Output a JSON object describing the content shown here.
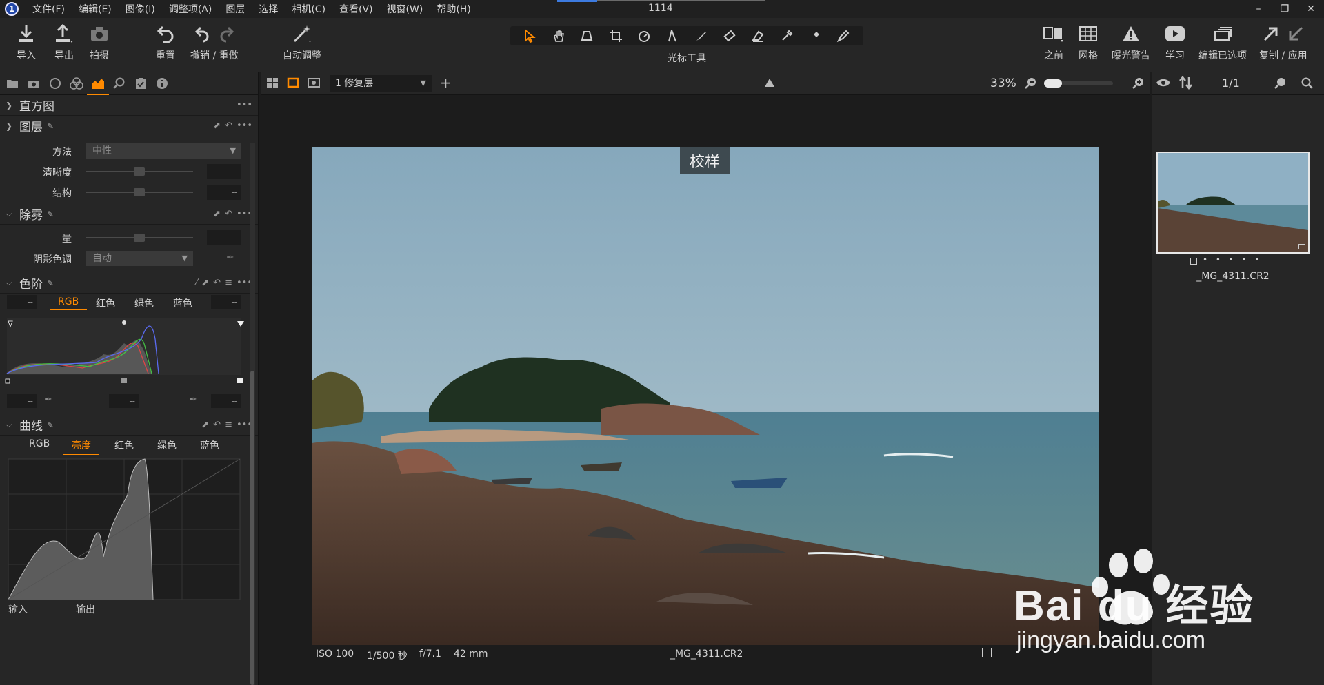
{
  "menubar": {
    "logo": "1",
    "items": [
      "文件(F)",
      "编辑(E)",
      "图像(I)",
      "调整项(A)",
      "图层",
      "选择",
      "相机(C)",
      "查看(V)",
      "视窗(W)",
      "帮助(H)"
    ],
    "title": "1114",
    "win_controls": [
      "–",
      "❐",
      "✕"
    ]
  },
  "toolbar": {
    "import": "导入",
    "export": "导出",
    "capture": "拍摄",
    "reset": "重置",
    "undo_redo": "撤销 / 重做",
    "auto_adjust": "自动调整",
    "cursor_tools": "光标工具",
    "before": "之前",
    "grid": "网格",
    "exposure_warning": "曝光警告",
    "learn": "学习",
    "edit_selected": "编辑已选项",
    "copy_apply": "复制 / 应用"
  },
  "left_panel": {
    "histogram_title": "直方图",
    "layers_title": "图层",
    "method_label": "方法",
    "method_value": "中性",
    "clarity_label": "清晰度",
    "structure_label": "结构",
    "dehaze_title": "除雾",
    "amount_label": "量",
    "shadow_tone_label": "阴影色调",
    "shadow_tone_value": "自动",
    "levels_title": "色阶",
    "levels_tabs": [
      "RGB",
      "红色",
      "绿色",
      "蓝色"
    ],
    "curves_title": "曲线",
    "curves_tabs": [
      "RGB",
      "亮度",
      "红色",
      "绿色",
      "蓝色"
    ],
    "input_label": "输入",
    "output_label": "输出",
    "empty_value": "--"
  },
  "viewer": {
    "layer_select": "1 修复层",
    "zoom": "33%",
    "proof_label": "校样",
    "iso": "ISO 100",
    "shutter": "1/500 秒",
    "aperture": "f/7.1",
    "focal": "42 mm",
    "filename": "_MG_4311.CR2"
  },
  "browser": {
    "count": "1/1",
    "thumb_name": "_MG_4311.CR2",
    "rating_dots": "• • • • •"
  },
  "watermark": {
    "brand": "Bai du 经验",
    "url": "jingyan.baidu.com"
  },
  "colors": {
    "accent": "#ff8a00",
    "sky": "#8fb0c4",
    "sea": "#5d8a9a"
  }
}
